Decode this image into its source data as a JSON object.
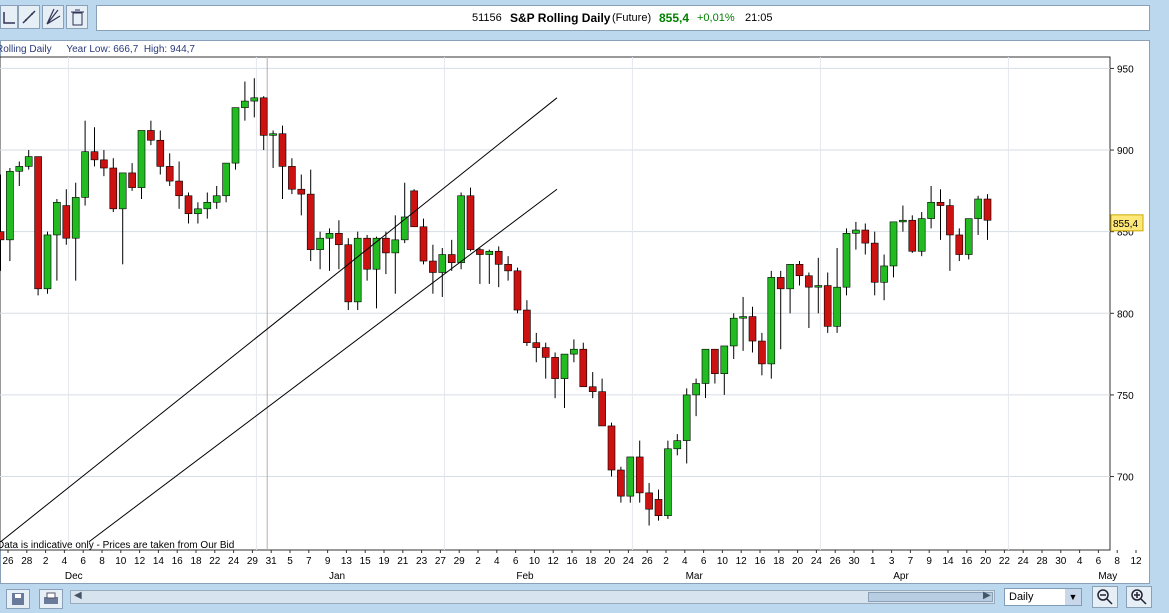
{
  "toolbar": {
    "icons": [
      "chart-tool-icon",
      "trendline-icon",
      "fan-icon",
      "trash-icon"
    ]
  },
  "header": {
    "code": "51156",
    "title": "S&P Rolling Daily",
    "type": "(Future)",
    "price": "855,4",
    "change": "+0,01%",
    "time": "21:05",
    "price_color": "#008000"
  },
  "info": {
    "name": "Rolling Daily",
    "range_text": "Year Low: 666,7  High: 944,7"
  },
  "disclaimer": "Data is indicative only - Prices are taken from Our Bid",
  "period_select": {
    "value": "Daily"
  },
  "chart_data": {
    "type": "candlestick",
    "ylim": [
      655,
      957
    ],
    "yticks": [
      700,
      750,
      800,
      850,
      900,
      950
    ],
    "last_price": 855.4,
    "last_label": "855,4",
    "up_color": "#22bb22",
    "down_color": "#cc1111",
    "day_labels": [
      "26",
      "28",
      "2",
      "4",
      "6",
      "8",
      "10",
      "12",
      "14",
      "16",
      "18",
      "22",
      "24",
      "29",
      "31",
      "5",
      "7",
      "9",
      "13",
      "15",
      "19",
      "21",
      "23",
      "27",
      "29",
      "2",
      "4",
      "6",
      "10",
      "12",
      "16",
      "18",
      "20",
      "24",
      "26",
      "2",
      "4",
      "6",
      "10",
      "12",
      "16",
      "18",
      "20",
      "24",
      "26",
      "30",
      "1",
      "3",
      "7",
      "9",
      "14",
      "16",
      "20",
      "22",
      "24",
      "28",
      "30",
      "4",
      "6",
      "8",
      "12"
    ],
    "month_labels": [
      {
        "label": "Dec",
        "after_index": 2
      },
      {
        "label": "Jan",
        "after_index": 16
      },
      {
        "label": "Feb",
        "after_index": 26
      },
      {
        "label": "Mar",
        "after_index": 35
      },
      {
        "label": "Apr",
        "after_index": 46
      },
      {
        "label": "May",
        "after_index": 57
      }
    ],
    "vline_after_index": 14,
    "trendlines": [
      {
        "from": [
          0,
          660
        ],
        "to": [
          59.2,
          932
        ]
      },
      {
        "from": [
          9.4,
          660
        ],
        "to": [
          59.2,
          876
        ]
      }
    ],
    "candles": [
      [
        850,
        885,
        826,
        845
      ],
      [
        845,
        889,
        832,
        887
      ],
      [
        887,
        893,
        878,
        890
      ],
      [
        890,
        900,
        888,
        896
      ],
      [
        896,
        896,
        811,
        815
      ],
      [
        815,
        850,
        812,
        848
      ],
      [
        848,
        870,
        820,
        868
      ],
      [
        866,
        876,
        842,
        846
      ],
      [
        846,
        880,
        820,
        871
      ],
      [
        871,
        918,
        866,
        899
      ],
      [
        899,
        914,
        890,
        894
      ],
      [
        894,
        900,
        884,
        889
      ],
      [
        889,
        895,
        862,
        864
      ],
      [
        864,
        886,
        830,
        886
      ],
      [
        886,
        892,
        875,
        877
      ],
      [
        877,
        912,
        870,
        912
      ],
      [
        912,
        918,
        903,
        906
      ],
      [
        906,
        912,
        885,
        890
      ],
      [
        890,
        898,
        878,
        881
      ],
      [
        881,
        893,
        864,
        872
      ],
      [
        872,
        874,
        855,
        861
      ],
      [
        861,
        868,
        855,
        864
      ],
      [
        864,
        874,
        858,
        868
      ],
      [
        868,
        878,
        864,
        872
      ],
      [
        872,
        892,
        868,
        892
      ],
      [
        892,
        916,
        888,
        926
      ],
      [
        926,
        942,
        918,
        930
      ],
      [
        930,
        944,
        920,
        932
      ],
      [
        932,
        933,
        900,
        909
      ],
      [
        909,
        912,
        889,
        910
      ],
      [
        910,
        915,
        870,
        890
      ],
      [
        890,
        895,
        873,
        876
      ],
      [
        876,
        885,
        860,
        873
      ],
      [
        873,
        888,
        832,
        839
      ],
      [
        839,
        850,
        827,
        846
      ],
      [
        846,
        852,
        826,
        849
      ],
      [
        849,
        857,
        827,
        842
      ],
      [
        842,
        846,
        802,
        807
      ],
      [
        807,
        850,
        802,
        846
      ],
      [
        846,
        848,
        820,
        827
      ],
      [
        827,
        847,
        803,
        846
      ],
      [
        846,
        850,
        824,
        837
      ],
      [
        837,
        860,
        812,
        845
      ],
      [
        845,
        880,
        843,
        859
      ],
      [
        875,
        876,
        853,
        853
      ],
      [
        853,
        858,
        830,
        832
      ],
      [
        832,
        842,
        812,
        825
      ],
      [
        825,
        840,
        810,
        836
      ],
      [
        836,
        845,
        826,
        831
      ],
      [
        831,
        874,
        827,
        872
      ],
      [
        872,
        877,
        838,
        839
      ],
      [
        839,
        840,
        818,
        836
      ],
      [
        836,
        839,
        818,
        838
      ],
      [
        838,
        841,
        816,
        830
      ],
      [
        830,
        835,
        820,
        826
      ],
      [
        826,
        828,
        800,
        802
      ],
      [
        802,
        808,
        780,
        782
      ],
      [
        782,
        788,
        770,
        779
      ],
      [
        779,
        782,
        760,
        773
      ],
      [
        773,
        776,
        748,
        760
      ],
      [
        760,
        773,
        742,
        775
      ],
      [
        775,
        784,
        770,
        778
      ],
      [
        778,
        782,
        755,
        755
      ],
      [
        755,
        764,
        748,
        752
      ],
      [
        752,
        760,
        733,
        731
      ],
      [
        731,
        733,
        700,
        704
      ],
      [
        704,
        706,
        684,
        688
      ],
      [
        688,
        712,
        684,
        712
      ],
      [
        712,
        722,
        684,
        690
      ],
      [
        690,
        696,
        670,
        680
      ],
      [
        686,
        692,
        673,
        676
      ],
      [
        676,
        722,
        674,
        717
      ],
      [
        717,
        726,
        713,
        722
      ],
      [
        722,
        754,
        708,
        750
      ],
      [
        750,
        760,
        737,
        757
      ],
      [
        757,
        778,
        748,
        778
      ],
      [
        778,
        778,
        757,
        763
      ],
      [
        763,
        780,
        750,
        780
      ],
      [
        780,
        800,
        772,
        797
      ],
      [
        797,
        810,
        777,
        798
      ],
      [
        798,
        804,
        776,
        783
      ],
      [
        783,
        788,
        762,
        769
      ],
      [
        769,
        826,
        760,
        822
      ],
      [
        822,
        826,
        778,
        815
      ],
      [
        815,
        824,
        800,
        830
      ],
      [
        830,
        832,
        817,
        823
      ],
      [
        823,
        825,
        791,
        816
      ],
      [
        816,
        834,
        800,
        817
      ],
      [
        817,
        825,
        788,
        792
      ],
      [
        792,
        840,
        788,
        816
      ],
      [
        816,
        852,
        811,
        849
      ],
      [
        849,
        856,
        839,
        851
      ],
      [
        851,
        855,
        836,
        843
      ],
      [
        843,
        850,
        811,
        819
      ],
      [
        819,
        836,
        808,
        829
      ],
      [
        829,
        850,
        822,
        856
      ],
      [
        856,
        866,
        850,
        857
      ],
      [
        857,
        860,
        837,
        838
      ],
      [
        838,
        862,
        835,
        858
      ],
      [
        858,
        878,
        852,
        868
      ],
      [
        868,
        876,
        845,
        866
      ],
      [
        866,
        870,
        826,
        848
      ],
      [
        848,
        852,
        832,
        836
      ],
      [
        836,
        858,
        833,
        858
      ],
      [
        858,
        872,
        848,
        870
      ],
      [
        870,
        873,
        845,
        857
      ]
    ]
  }
}
